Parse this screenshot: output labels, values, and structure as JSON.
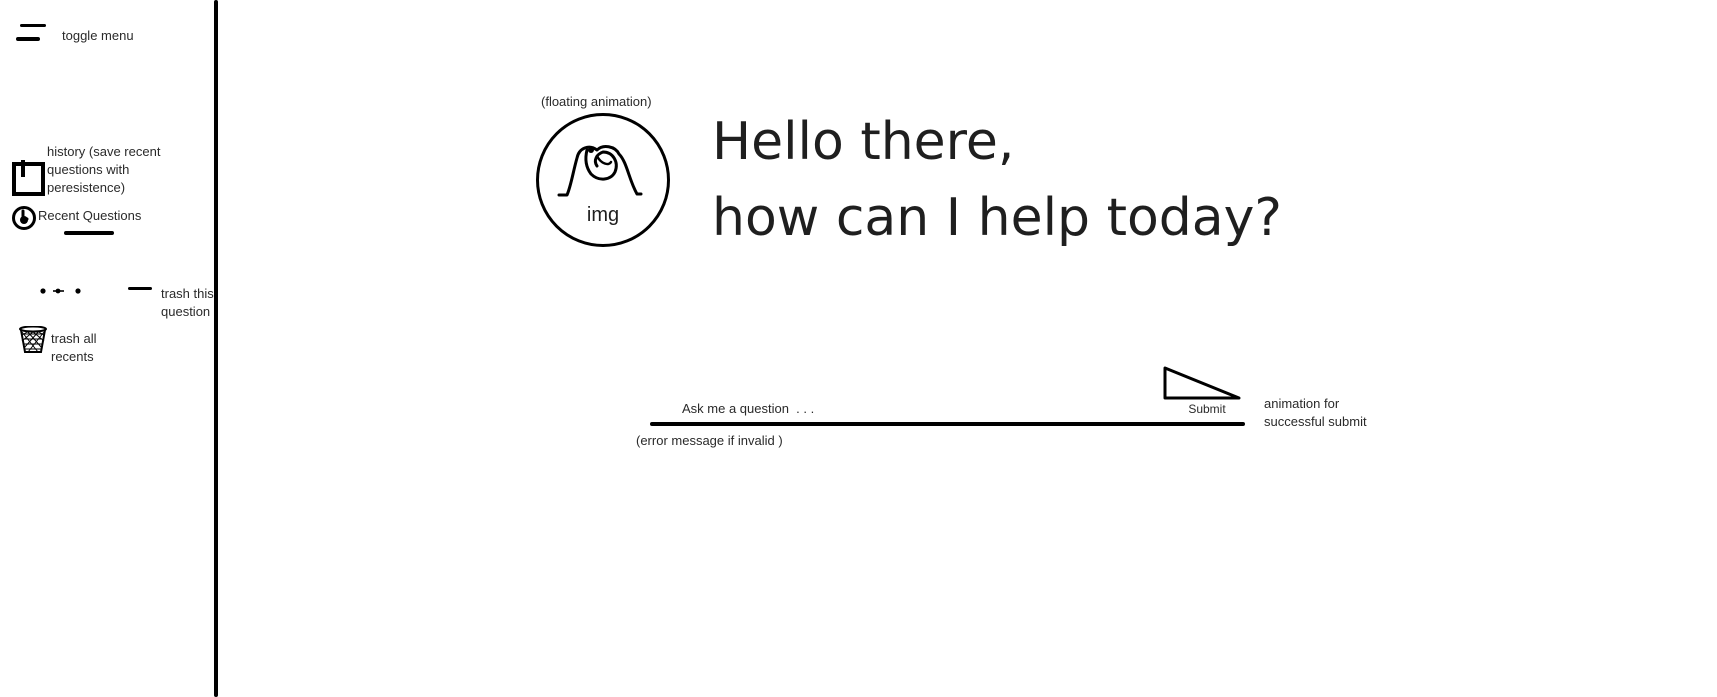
{
  "sidebar": {
    "toggle_menu_label": "toggle menu",
    "history_note": [
      "history (save recent",
      "questions with",
      "peresistence)"
    ],
    "recent_questions_label": "Recent Questions",
    "trash_this_note": [
      "trash this",
      "question"
    ],
    "trash_all_note": [
      "trash all",
      "recents"
    ],
    "icons": {
      "toggle": "hamburger-menu-icon",
      "history": "bookmark-icon",
      "recent": "clock-icon",
      "more": "ellipsis-icon",
      "trash_one": "dash-icon",
      "trash_all": "wastebasket-icon"
    }
  },
  "main": {
    "avatar_note": "(floating animation)",
    "avatar_label": "img",
    "greeting_line1": "Hello there,",
    "greeting_line2": "how can I help today?",
    "question": {
      "placeholder": "Ask me a question  . . .",
      "value": "",
      "error_note": "(error message if invalid )"
    },
    "submit": {
      "label": "Submit",
      "icon": "send-triangle-icon",
      "animation_note": [
        "animation for",
        "successful submit"
      ]
    }
  },
  "colors": {
    "ink": "#000000",
    "text": "#222222",
    "background": "#ffffff"
  }
}
